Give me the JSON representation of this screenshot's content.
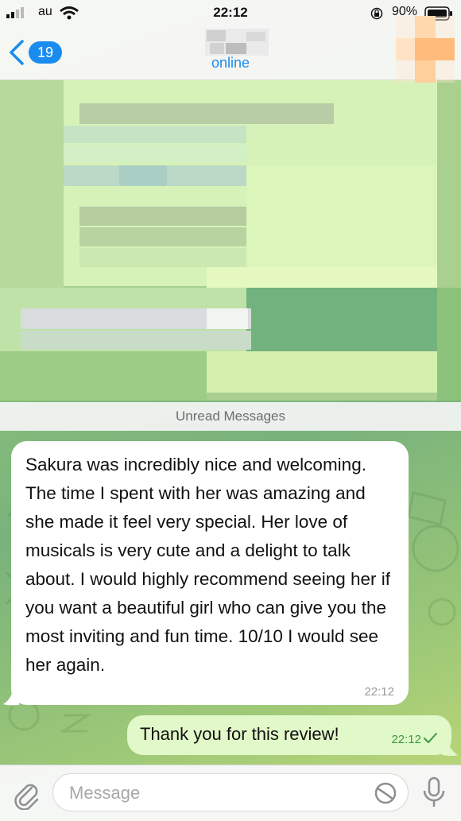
{
  "status_bar": {
    "carrier": "au",
    "time": "22:12",
    "battery": "90%"
  },
  "nav": {
    "back_count": "19",
    "status": "online"
  },
  "divider": "Unread Messages",
  "messages": [
    {
      "direction": "incoming",
      "text": "Sakura was incredibly nice and welcoming. The time I spent with her was amazing and she made it feel very special. Her love of musicals is very cute and a delight to talk about. I would highly recommend seeing her if you want a beautiful girl who can give you the most inviting and fun time. 10/10 I would see her again.",
      "time": "22:12"
    },
    {
      "direction": "outgoing",
      "text": "Thank you for this review!",
      "time": "22:12"
    }
  ],
  "composer": {
    "placeholder": "Message"
  },
  "colors": {
    "accent": "#1a8cf0",
    "outgoing_bubble": "#e1f8c8",
    "incoming_bubble": "#ffffff",
    "read_check": "#3a9a3f"
  }
}
